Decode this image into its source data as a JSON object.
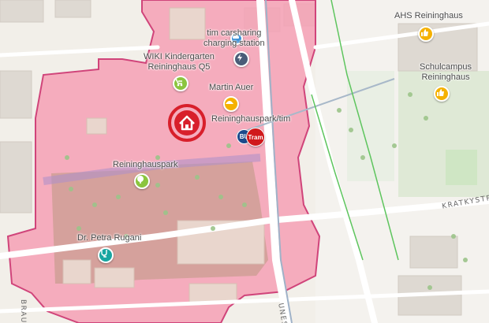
{
  "map": {
    "colors": {
      "boundary_fill": "#f6a0b5",
      "boundary_stroke": "#d0447a",
      "green_area": "#d3e7c8",
      "home_marker": "#d81f2b",
      "kindergarten_poi": "#8bc53f",
      "charging_poi": "#4a5d78",
      "carsharing_poi": "#3a8fd6",
      "martin_auer_poi": "#f5b100",
      "school_poi": "#f5b100",
      "park_poi": "#8bc53f",
      "doctor_poi": "#19a6a1",
      "tram_stop": "#d0191b",
      "bus_stop": "#1b4a8c"
    },
    "pois": {
      "ahs": "AHS Reininghaus",
      "schulcampus": "Schulcampus\nReininghaus",
      "carsharing": "tim carsharing\ncharging station",
      "kindergarten": "WIKI Kindergarten\nReininghaus Q5",
      "martin_auer": "Martin Auer",
      "tram_stop_name": "Reininghauspark/tim",
      "park": "Reininghauspark",
      "doctor": "Dr. Petra Rugani"
    },
    "transit": {
      "bus_label": "BU",
      "tram_label": "Tram"
    },
    "streets": {
      "kratkystrasse": "KRATKYSTR",
      "unesco": "UNES",
      "brauhaus": "BRAU"
    },
    "icons": {
      "home": "home-icon",
      "kindergarten": "stroller-icon",
      "charging": "lightning-icon",
      "carsharing": "car-icon",
      "bakery": "bread-icon",
      "school": "thumb-up-icon",
      "park": "tree-icon",
      "doctor": "stethoscope-icon"
    }
  }
}
